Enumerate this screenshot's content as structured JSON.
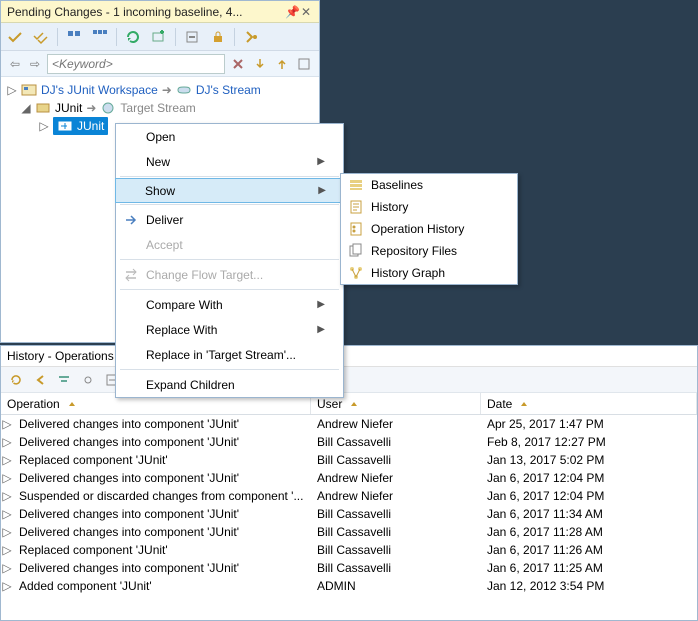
{
  "pending": {
    "title": "Pending Changes - 1 incoming baseline, 4...",
    "search_placeholder": "<Keyword>",
    "tree": {
      "workspace": "DJ's JUnit Workspace",
      "dj_stream": "DJ's Stream",
      "component_top": "JUnit",
      "target_stream": "Target Stream",
      "selected_component": "JUnit"
    }
  },
  "context_menu": {
    "open": "Open",
    "new": "New",
    "show": "Show",
    "deliver": "Deliver",
    "accept": "Accept",
    "change_flow": "Change Flow Target...",
    "compare_with": "Compare With",
    "replace_with": "Replace With",
    "replace_in": "Replace in 'Target Stream'...",
    "expand_children": "Expand Children"
  },
  "show_submenu": {
    "baselines": "Baselines",
    "history": "History",
    "operation_history": "Operation History",
    "repository_files": "Repository Files",
    "history_graph": "History Graph"
  },
  "history": {
    "title": "History - Operations",
    "columns": {
      "operation": "Operation",
      "user": "User",
      "date": "Date"
    },
    "rows": [
      {
        "op": "Delivered changes into component 'JUnit'",
        "user": "Andrew Niefer",
        "date": "Apr 25, 2017 1:47 PM"
      },
      {
        "op": "Delivered changes into component 'JUnit'",
        "user": "Bill Cassavelli",
        "date": "Feb 8, 2017 12:27 PM"
      },
      {
        "op": "Replaced component 'JUnit'",
        "user": "Bill Cassavelli",
        "date": "Jan 13, 2017 5:02 PM"
      },
      {
        "op": "Delivered changes into component 'JUnit'",
        "user": "Andrew Niefer",
        "date": "Jan 6, 2017 12:04 PM"
      },
      {
        "op": "Suspended or discarded changes from component '...",
        "user": "Andrew Niefer",
        "date": "Jan 6, 2017 12:04 PM"
      },
      {
        "op": "Delivered changes into component 'JUnit'",
        "user": "Bill Cassavelli",
        "date": "Jan 6, 2017 11:34 AM"
      },
      {
        "op": "Delivered changes into component 'JUnit'",
        "user": "Bill Cassavelli",
        "date": "Jan 6, 2017 11:28 AM"
      },
      {
        "op": "Replaced component 'JUnit'",
        "user": "Bill Cassavelli",
        "date": "Jan 6, 2017 11:26 AM"
      },
      {
        "op": "Delivered changes into component 'JUnit'",
        "user": "Bill Cassavelli",
        "date": "Jan 6, 2017 11:25 AM"
      },
      {
        "op": "Added component 'JUnit'",
        "user": "ADMIN",
        "date": "Jan 12, 2012 3:54 PM"
      }
    ]
  },
  "colors": {
    "accent": "#0a84d6",
    "highlight": "#d6ebf8",
    "highlight_border": "#6fb8e6"
  }
}
